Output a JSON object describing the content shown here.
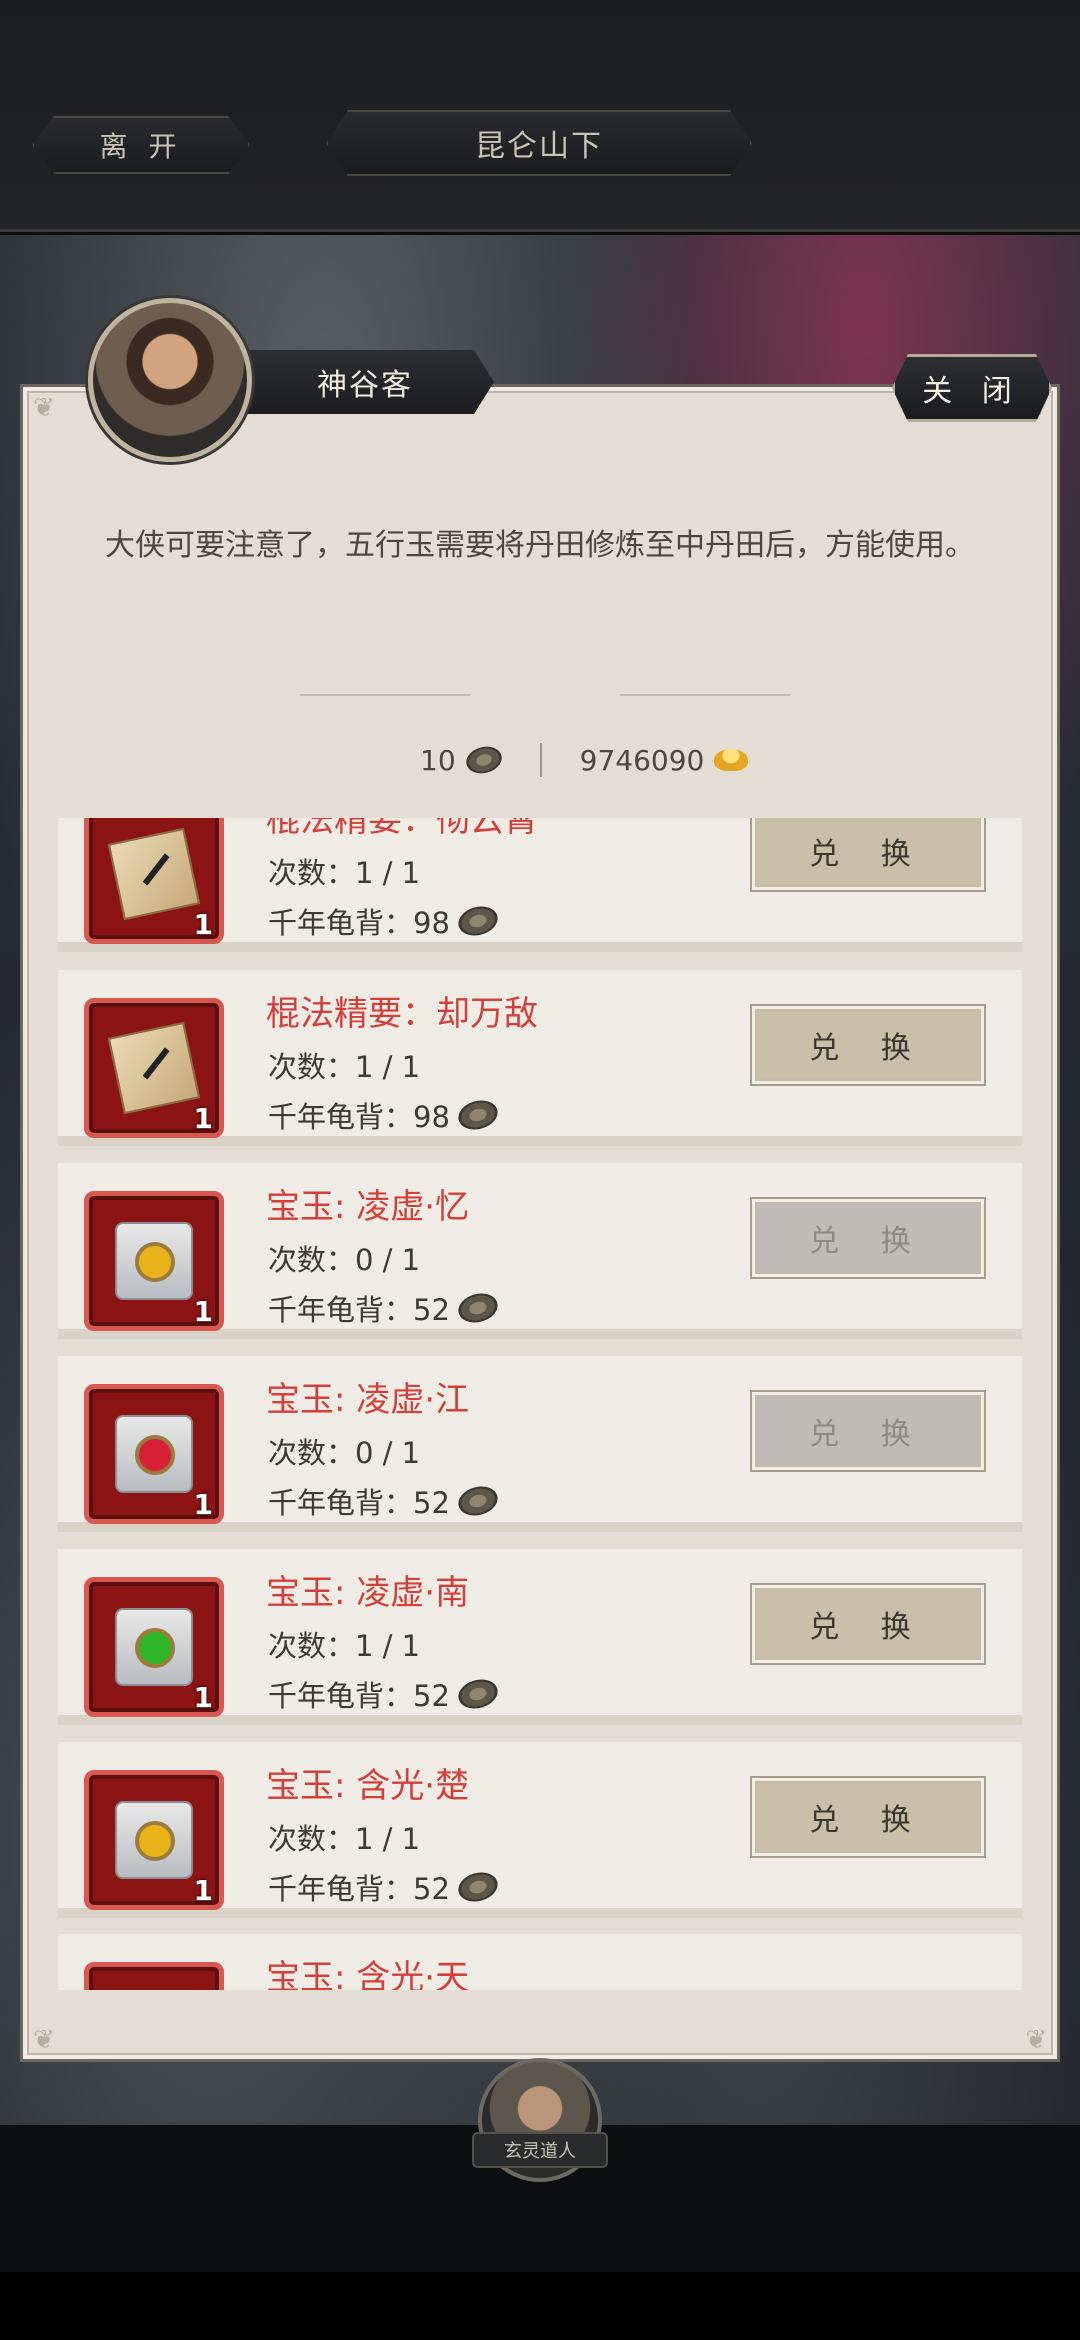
{
  "header": {
    "leave_label": "离 开",
    "location": "昆仑山下"
  },
  "npc": {
    "name": "神谷客",
    "close_label": "关 闭",
    "notice": "大侠可要注意了，五行玉需要将丹田修炼至中丹田后，方能使用。"
  },
  "currency": {
    "shells": "10",
    "ingots": "9746090"
  },
  "items": [
    {
      "name": "棍法精要：彻云霄",
      "times": "次数：1 / 1",
      "cost_label": "千年龟背：98",
      "count": "1",
      "icon": "book-icon",
      "button": "兑 换",
      "enabled": true
    },
    {
      "name": "棍法精要：却万敌",
      "times": "次数：1 / 1",
      "cost_label": "千年龟背：98",
      "count": "1",
      "icon": "book-icon",
      "button": "兑 换",
      "enabled": true
    },
    {
      "name": "宝玉: 凌虚·忆",
      "times": "次数：0 / 1",
      "cost_label": "千年龟背：52",
      "count": "1",
      "icon": "yellow-gem-icon",
      "gem_color": "#e7b318",
      "button": "兑 换",
      "enabled": false
    },
    {
      "name": "宝玉: 凌虚·江",
      "times": "次数：0 / 1",
      "cost_label": "千年龟背：52",
      "count": "1",
      "icon": "red-gem-icon",
      "gem_color": "#d71f35",
      "button": "兑 换",
      "enabled": false
    },
    {
      "name": "宝玉: 凌虚·南",
      "times": "次数：1 / 1",
      "cost_label": "千年龟背：52",
      "count": "1",
      "icon": "green-gem-icon",
      "gem_color": "#2fb52a",
      "button": "兑 换",
      "enabled": true
    },
    {
      "name": "宝玉: 含光·楚",
      "times": "次数：1 / 1",
      "cost_label": "千年龟背：52",
      "count": "1",
      "icon": "yellow-gem-icon",
      "gem_color": "#e7b318",
      "button": "兑 换",
      "enabled": true
    },
    {
      "name": "宝玉: 含光·天",
      "times": "",
      "cost_label": "",
      "count": "",
      "icon": "gem-icon",
      "gem_color": "#e7b318",
      "button": "",
      "enabled": true
    }
  ],
  "footer_npc": {
    "label": "玄灵道人"
  }
}
